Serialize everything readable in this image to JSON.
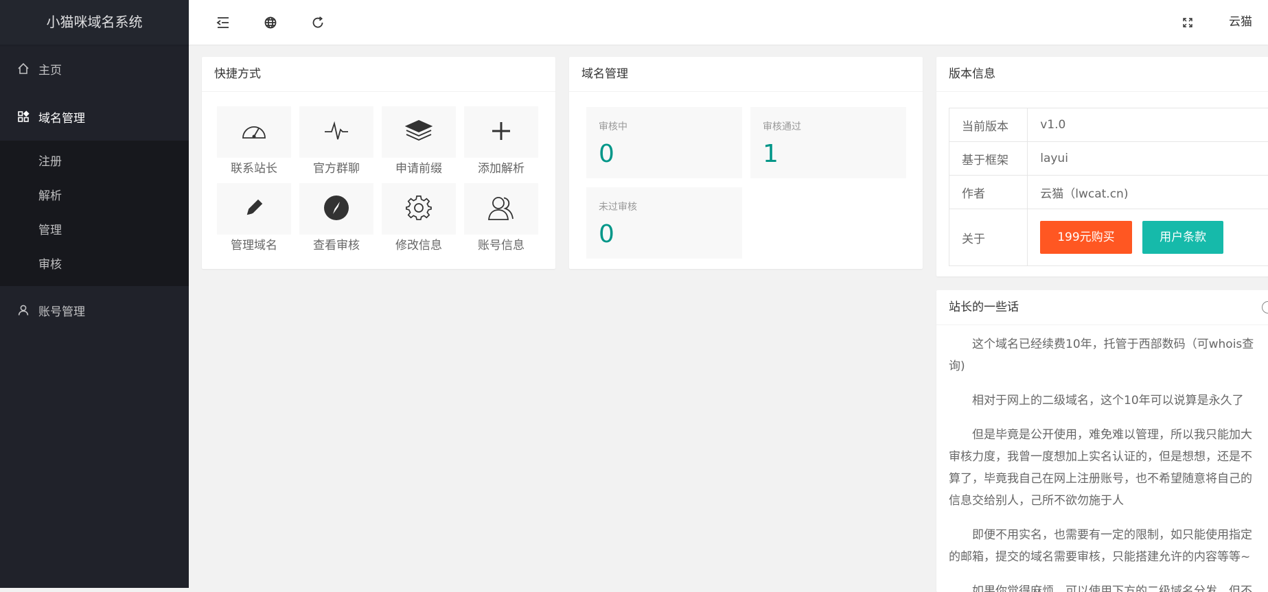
{
  "sidebar": {
    "logo": "小猫咪域名系统",
    "items": [
      {
        "label": "主页",
        "icon": "home-icon"
      },
      {
        "label": "域名管理",
        "icon": "apps-icon"
      },
      {
        "label": "账号管理",
        "icon": "user-icon"
      }
    ],
    "sub_items": [
      "注册",
      "解析",
      "管理",
      "审核"
    ]
  },
  "header": {
    "user": "云猫",
    "icons": [
      "shrink-menu-icon",
      "globe-icon",
      "refresh-icon",
      "fullscreen-icon"
    ]
  },
  "shortcuts": {
    "title": "快捷方式",
    "items": [
      {
        "label": "联系站长",
        "icon": "dashboard-icon"
      },
      {
        "label": "官方群聊",
        "icon": "pulse-icon"
      },
      {
        "label": "申请前缀",
        "icon": "layers-icon"
      },
      {
        "label": "添加解析",
        "icon": "plus-icon"
      },
      {
        "label": "管理域名",
        "icon": "pencil-icon"
      },
      {
        "label": "查看审核",
        "icon": "compass-icon"
      },
      {
        "label": "修改信息",
        "icon": "gear-icon"
      },
      {
        "label": "账号信息",
        "icon": "users-icon"
      }
    ]
  },
  "domain": {
    "title": "域名管理",
    "stats": [
      {
        "label": "审核中",
        "value": "0"
      },
      {
        "label": "审核通过",
        "value": "1"
      },
      {
        "label": "未过审核",
        "value": "0"
      }
    ]
  },
  "version": {
    "title": "版本信息",
    "rows": [
      {
        "key": "当前版本",
        "value": "v1.0"
      },
      {
        "key": "基于框架",
        "value": "layui"
      },
      {
        "key": "作者",
        "value": "云猫（lwcat.cn)"
      },
      {
        "key": "关于",
        "value": ""
      }
    ],
    "buy_label": "199元购买",
    "terms_label": "用户条款",
    "colors": {
      "buy": "#ff5722",
      "terms": "#16baaa",
      "accent": "#009688"
    }
  },
  "notes": {
    "title": "站长的一些话",
    "paragraphs": [
      "这个域名已经续费10年，托管于西部数码（可whois查询)",
      "相对于网上的二级域名，这个10年可以说算是永久了",
      "但是毕竟是公开使用，难免难以管理，所以我只能加大审核力度，我曾一度想加上实名认证的，但是想想，还是不算了，毕竟我自己在网上注册账号，也不希望随意将自己的信息交给别人，己所不欲勿施于人",
      "即便不用实名，也需要有一定的限制，如只能使用指定的邮箱，提交的域名需要审核，只能搭建允许的内容等等~",
      "如果你觉得麻烦，可以使用下方的二级域名分发，但不"
    ]
  }
}
